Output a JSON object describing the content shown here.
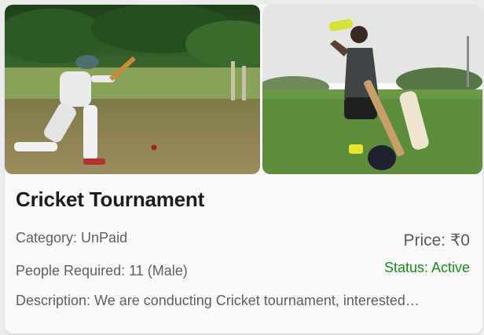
{
  "event": {
    "title": "Cricket Tournament",
    "category": "Category: UnPaid",
    "price": "Price: ₹0",
    "people_required": "People Required: 11 (Male)",
    "status": "Status: Active",
    "description": "Description: We are conducting Cricket tournament, interested…",
    "colors": {
      "status": "#1b8a1b",
      "title": "#1c1c1c",
      "body_text": "#5f5f5f"
    }
  }
}
